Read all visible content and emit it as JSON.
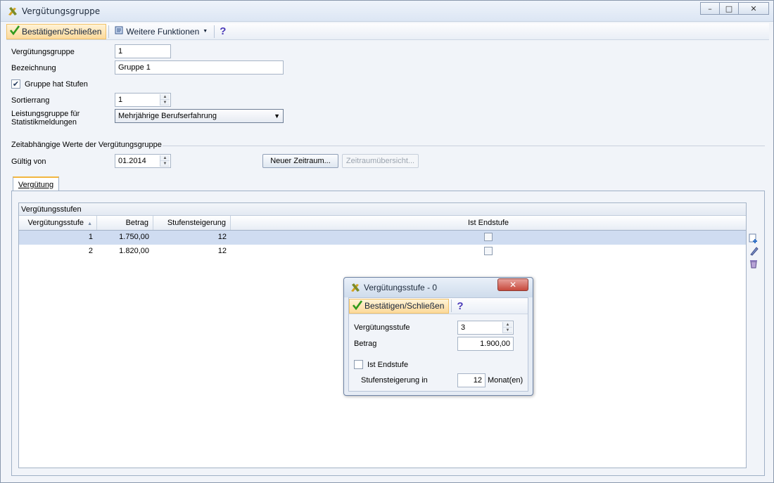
{
  "window": {
    "title": "Vergütungsgruppe",
    "controls": {
      "minimize": "–",
      "restore": "□",
      "close": "✕"
    }
  },
  "toolbar": {
    "confirm_label": "Bestätigen/Schließen",
    "more_label": "Weitere Funktionen",
    "help_label": "?"
  },
  "form": {
    "verguetungsgruppe_label": "Vergütungsgruppe",
    "verguetungsgruppe_value": "1",
    "bezeichnung_label": "Bezeichnung",
    "bezeichnung_value": "Gruppe 1",
    "has_stufen_label": "Gruppe hat Stufen",
    "has_stufen_checked": true,
    "sortierrang_label": "Sortierrang",
    "sortierrang_value": "1",
    "leistungsgruppe_label_1": "Leistungsgruppe für",
    "leistungsgruppe_label_2": "Statistikmeldungen",
    "leistungsgruppe_value": "Mehrjährige Berufserfahrung"
  },
  "zeit": {
    "section_label": "Zeitabhängige Werte der Vergütungsgruppe",
    "gueltig_label": "Gültig von",
    "gueltig_value": "01.2014",
    "new_period_button": "Neuer Zeitraum...",
    "overview_button": "Zeitraumübersicht..."
  },
  "tabs": [
    {
      "label": "Vergütung",
      "active": true
    }
  ],
  "grid": {
    "caption": "Vergütungsstufen",
    "headers": [
      "Vergütungsstufe",
      "Betrag",
      "Stufensteigerung",
      "Ist Endstufe"
    ],
    "sort_indicator": "▲",
    "rows": [
      {
        "stufe": "1",
        "betrag": "1.750,00",
        "steigerung": "12",
        "endstufe": false,
        "selected": true
      },
      {
        "stufe": "2",
        "betrag": "1.820,00",
        "steigerung": "12",
        "endstufe": false,
        "selected": false
      }
    ]
  },
  "side_tools": [
    "add-icon",
    "edit-icon",
    "delete-icon"
  ],
  "dialog": {
    "title": "Vergütungsstufe - 0",
    "close": "✕",
    "confirm_label": "Bestätigen/Schließen",
    "help_label": "?",
    "stufe_label": "Vergütungsstufe",
    "stufe_value": "3",
    "betrag_label": "Betrag",
    "betrag_value": "1.900,00",
    "endstufe_label": "Ist Endstufe",
    "endstufe_checked": false,
    "steigerung_label": "Stufensteigerung in",
    "steigerung_value": "12",
    "steigerung_unit": "Monat(en)"
  },
  "colors": {
    "accent": "#fcd99a",
    "selection": "#cfdcf1",
    "close_red": "#c7493c",
    "check_green": "#2f9a1d"
  }
}
